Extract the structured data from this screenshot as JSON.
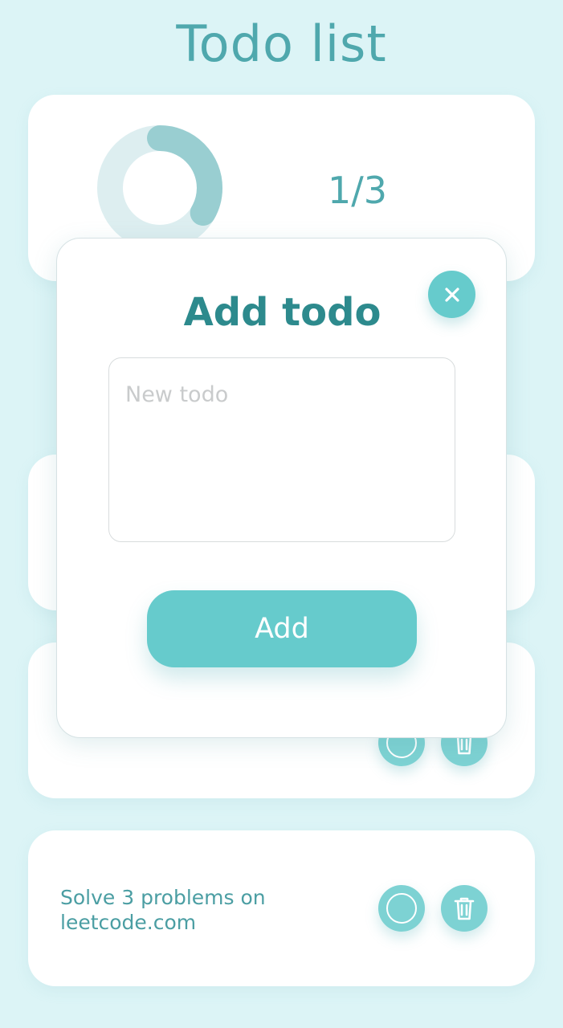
{
  "app": {
    "title": "Todo list"
  },
  "progress": {
    "completed": 1,
    "total": 3,
    "label": "1/3",
    "fraction": 0.3333
  },
  "todos": [
    {
      "text": "",
      "done": false
    },
    {
      "text": "",
      "done": false
    },
    {
      "text": "Solve 3 problems on leetcode.com",
      "done": false
    }
  ],
  "modal": {
    "title": "Add todo",
    "input_value": "",
    "input_placeholder": "New todo",
    "submit_label": "Add"
  },
  "colors": {
    "background": "#dcf4f6",
    "accent": "#66cbcc",
    "title_text": "#4fa8ad",
    "ring_track": "#ddeef0",
    "ring_fill": "#99ced1"
  },
  "icons": {
    "close": "close-icon",
    "check": "circle-check-icon",
    "delete": "trash-icon"
  }
}
